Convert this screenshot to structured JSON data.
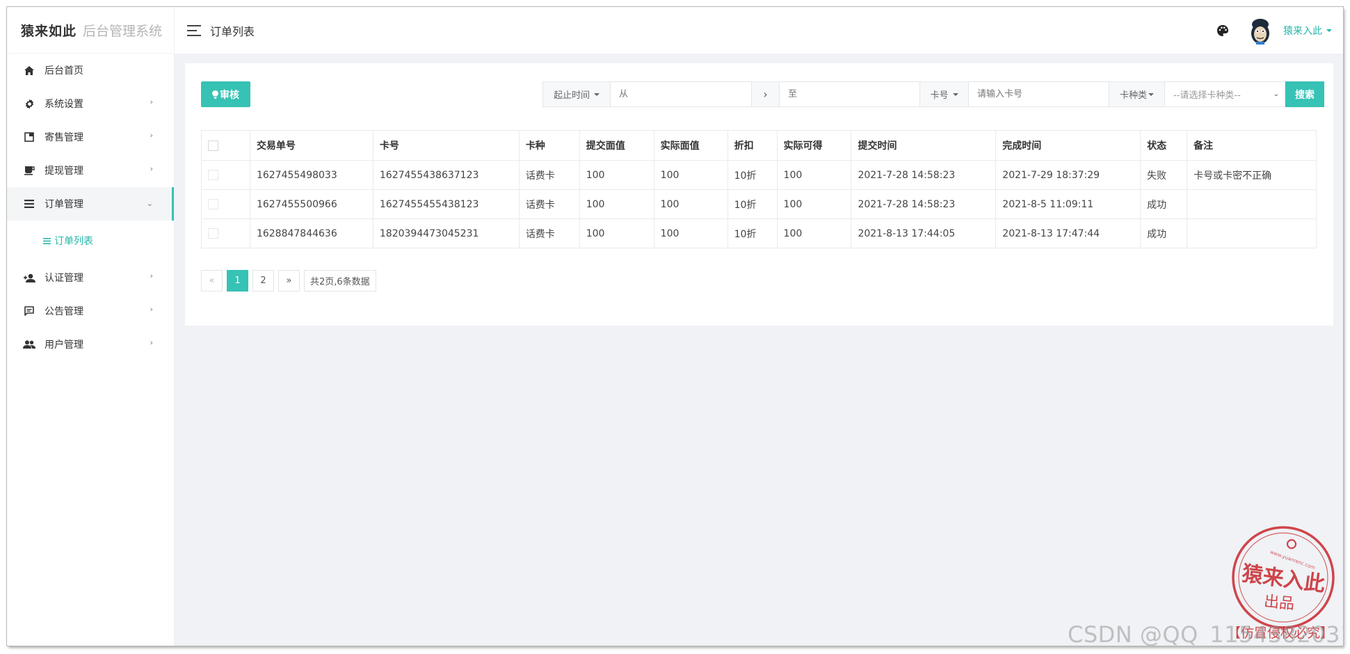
{
  "colors": {
    "accent": "#36c2b4",
    "accent_text": "#26b5a8",
    "stamp": "#c8272d"
  },
  "brand": {
    "name": "猿来如此",
    "system": "后台管理系统"
  },
  "sidebar": {
    "items": [
      {
        "label": "后台首页",
        "icon": "home-icon",
        "has_children": false
      },
      {
        "label": "系统设置",
        "icon": "gear-icon",
        "has_children": true
      },
      {
        "label": "寄售管理",
        "icon": "card-icon",
        "has_children": true
      },
      {
        "label": "提现管理",
        "icon": "coffee-icon",
        "has_children": true
      },
      {
        "label": "订单管理",
        "icon": "list-icon",
        "has_children": true,
        "expanded": true
      },
      {
        "label": "认证管理",
        "icon": "person-add-icon",
        "has_children": true
      },
      {
        "label": "公告管理",
        "icon": "message-icon",
        "has_children": true
      },
      {
        "label": "用户管理",
        "icon": "users-icon",
        "has_children": true
      }
    ],
    "submenu": {
      "label": "订单列表",
      "icon": "list-icon",
      "active": true
    }
  },
  "header": {
    "title": "订单列表",
    "user": "猿来入此",
    "icons": [
      "menu-icon",
      "palette-icon",
      "avatar"
    ]
  },
  "toolbar": {
    "audit_label": "审核",
    "time_filter_label": "起止时间",
    "from_placeholder": "从",
    "arrow": "›",
    "to_placeholder": "至",
    "card_filter_label": "卡号",
    "card_placeholder": "请输入卡号",
    "type_filter_label": "卡种类",
    "type_select_value": "--请选择卡种类--",
    "search_label": "搜索"
  },
  "table": {
    "columns": [
      "交易单号",
      "卡号",
      "卡种",
      "提交面值",
      "实际面值",
      "折扣",
      "实际可得",
      "提交时间",
      "完成时间",
      "状态",
      "备注"
    ],
    "rows": [
      [
        "1627455498033",
        "1627455438637123",
        "话费卡",
        "100",
        "100",
        "10折",
        "100",
        "2021-7-28 14:58:23",
        "2021-7-29 18:37:29",
        "失败",
        "卡号或卡密不正确"
      ],
      [
        "1627455500966",
        "1627455455438123",
        "话费卡",
        "100",
        "100",
        "10折",
        "100",
        "2021-7-28 14:58:23",
        "2021-8-5 11:09:11",
        "成功",
        ""
      ],
      [
        "1628847844636",
        "1820394473045231",
        "话费卡",
        "100",
        "100",
        "10折",
        "100",
        "2021-8-13 17:44:05",
        "2021-8-13 17:47:44",
        "成功",
        ""
      ]
    ]
  },
  "pagination": {
    "prev": "«",
    "pages": [
      "1",
      "2"
    ],
    "current": "1",
    "next": "»",
    "info": "共2页,6条数据"
  },
  "stamp": {
    "main": "猿来入此",
    "sub": "出品",
    "url": "www.yuanrenc.com",
    "footer": "【仿冒侵权必究】"
  },
  "watermark": "CSDN @QQ_1154382031"
}
